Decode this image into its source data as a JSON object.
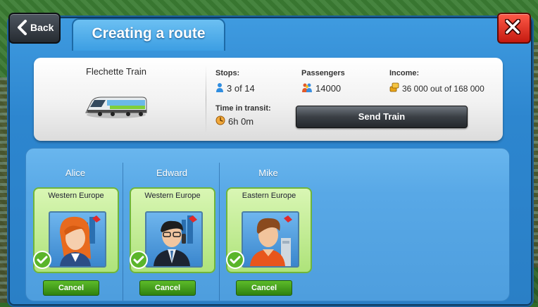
{
  "header": {
    "back_label": "Back",
    "title": "Creating a route"
  },
  "train": {
    "name": "Flechette Train"
  },
  "stats": {
    "stops_label": "Stops:",
    "stops_value": "3 of 14",
    "passengers_label": "Passengers",
    "passengers_value": "14000",
    "income_label": "Income:",
    "income_value": "36 000 out of 168 000",
    "transit_label": "Time in transit:",
    "transit_value": "6h 0m"
  },
  "send_button": "Send Train",
  "crew": [
    {
      "name": "Alice",
      "region": "Western Europe",
      "cancel": "Cancel"
    },
    {
      "name": "Edward",
      "region": "Western Europe",
      "cancel": "Cancel"
    },
    {
      "name": "Mike",
      "region": "Eastern Europe",
      "cancel": "Cancel"
    }
  ],
  "icons": {
    "back": "chevron-left-icon",
    "close": "close-icon",
    "stops": "person-icon",
    "passengers": "passengers-icon",
    "income": "coins-icon",
    "transit": "clock-icon",
    "assigned": "checkmark-icon"
  },
  "colors": {
    "dialog_blue": "#2d86cf",
    "card_green": "#aee37a",
    "close_red": "#c41a10",
    "cancel_green": "#2f8210"
  }
}
